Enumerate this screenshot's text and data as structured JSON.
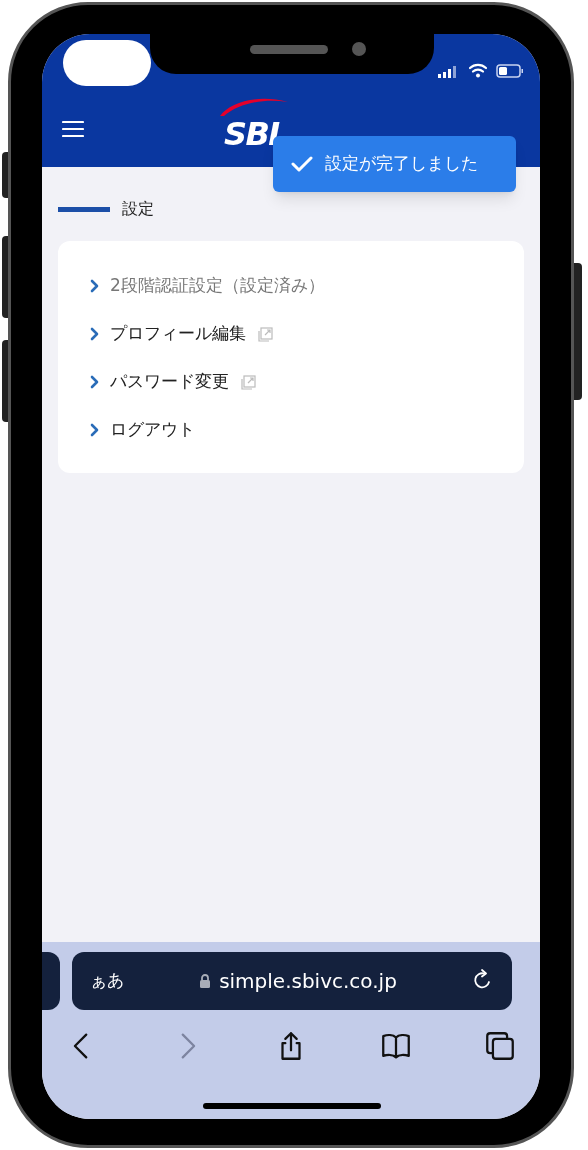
{
  "header": {
    "logo": "SBI"
  },
  "toast": {
    "message": "設定が完了しました"
  },
  "section": {
    "title": "設定"
  },
  "menu": [
    {
      "label": "2段階認証設定（設定済み）",
      "disabled": true,
      "external": false
    },
    {
      "label": "プロフィール編集",
      "disabled": false,
      "external": true
    },
    {
      "label": "パスワード変更",
      "disabled": false,
      "external": true
    },
    {
      "label": "ログアウト",
      "disabled": false,
      "external": false
    }
  ],
  "browser": {
    "text_size_button": "ぁあ",
    "url": "simple.sbivc.co.jp",
    "toolbar": [
      {
        "kind": "back",
        "disabled": false
      },
      {
        "kind": "forward",
        "disabled": true
      },
      {
        "kind": "share",
        "disabled": false
      },
      {
        "kind": "bookmarks",
        "disabled": false
      },
      {
        "kind": "tabs",
        "disabled": false
      }
    ]
  }
}
